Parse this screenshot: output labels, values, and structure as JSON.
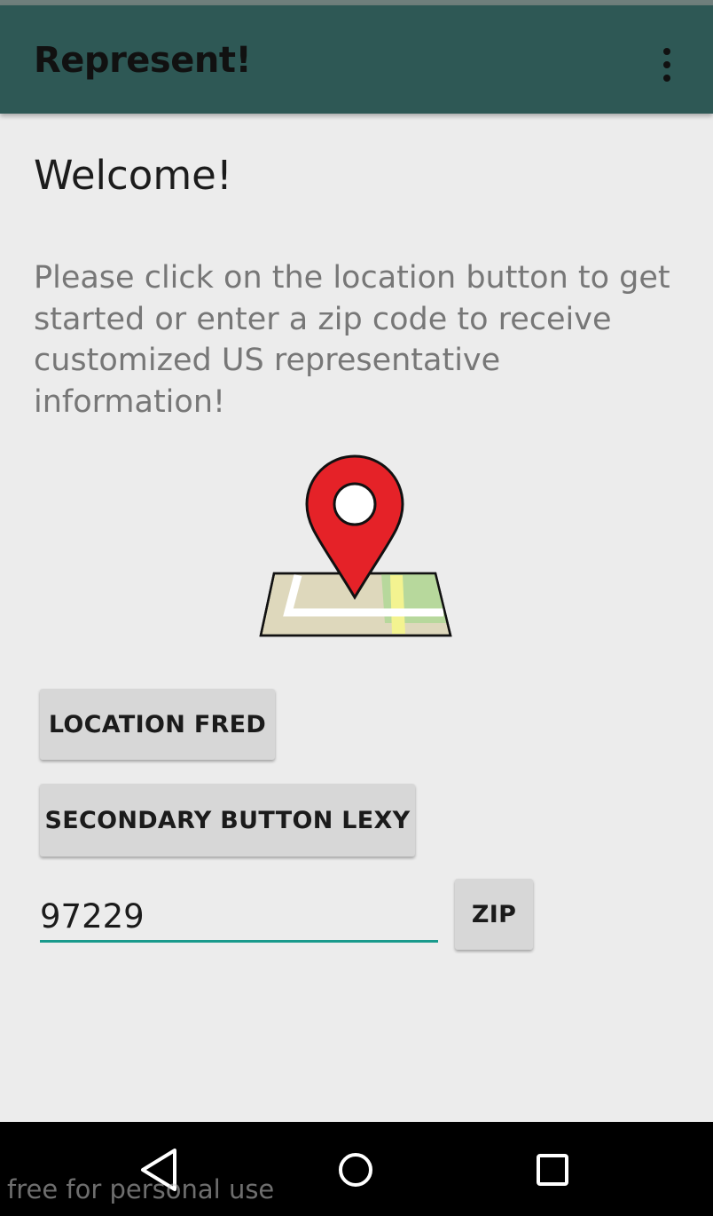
{
  "app_bar": {
    "title": "Represent!",
    "menu_icon": "more-vert-icon"
  },
  "main": {
    "welcome": "Welcome!",
    "intro": "Please click on the location button to get started or enter a zip code to receive customized US representative information!",
    "map_icon": "map-location-pin-icon",
    "location_button_label": "LOCATION FRED",
    "secondary_button_label": "SECONDARY BUTTON LEXY",
    "zip_input_value": "97229",
    "zip_button_label": "ZIP"
  },
  "nav_bar": {
    "back_icon": "back-triangle-icon",
    "home_icon": "home-circle-icon",
    "recents_icon": "recents-square-icon"
  },
  "watermark": "free for personal use",
  "colors": {
    "app_bar": "#2e5855",
    "background": "#ececec",
    "button": "#d7d7d7",
    "input_underline": "#199a8c",
    "pin_red": "#e52228",
    "nav_bar": "#000000"
  }
}
